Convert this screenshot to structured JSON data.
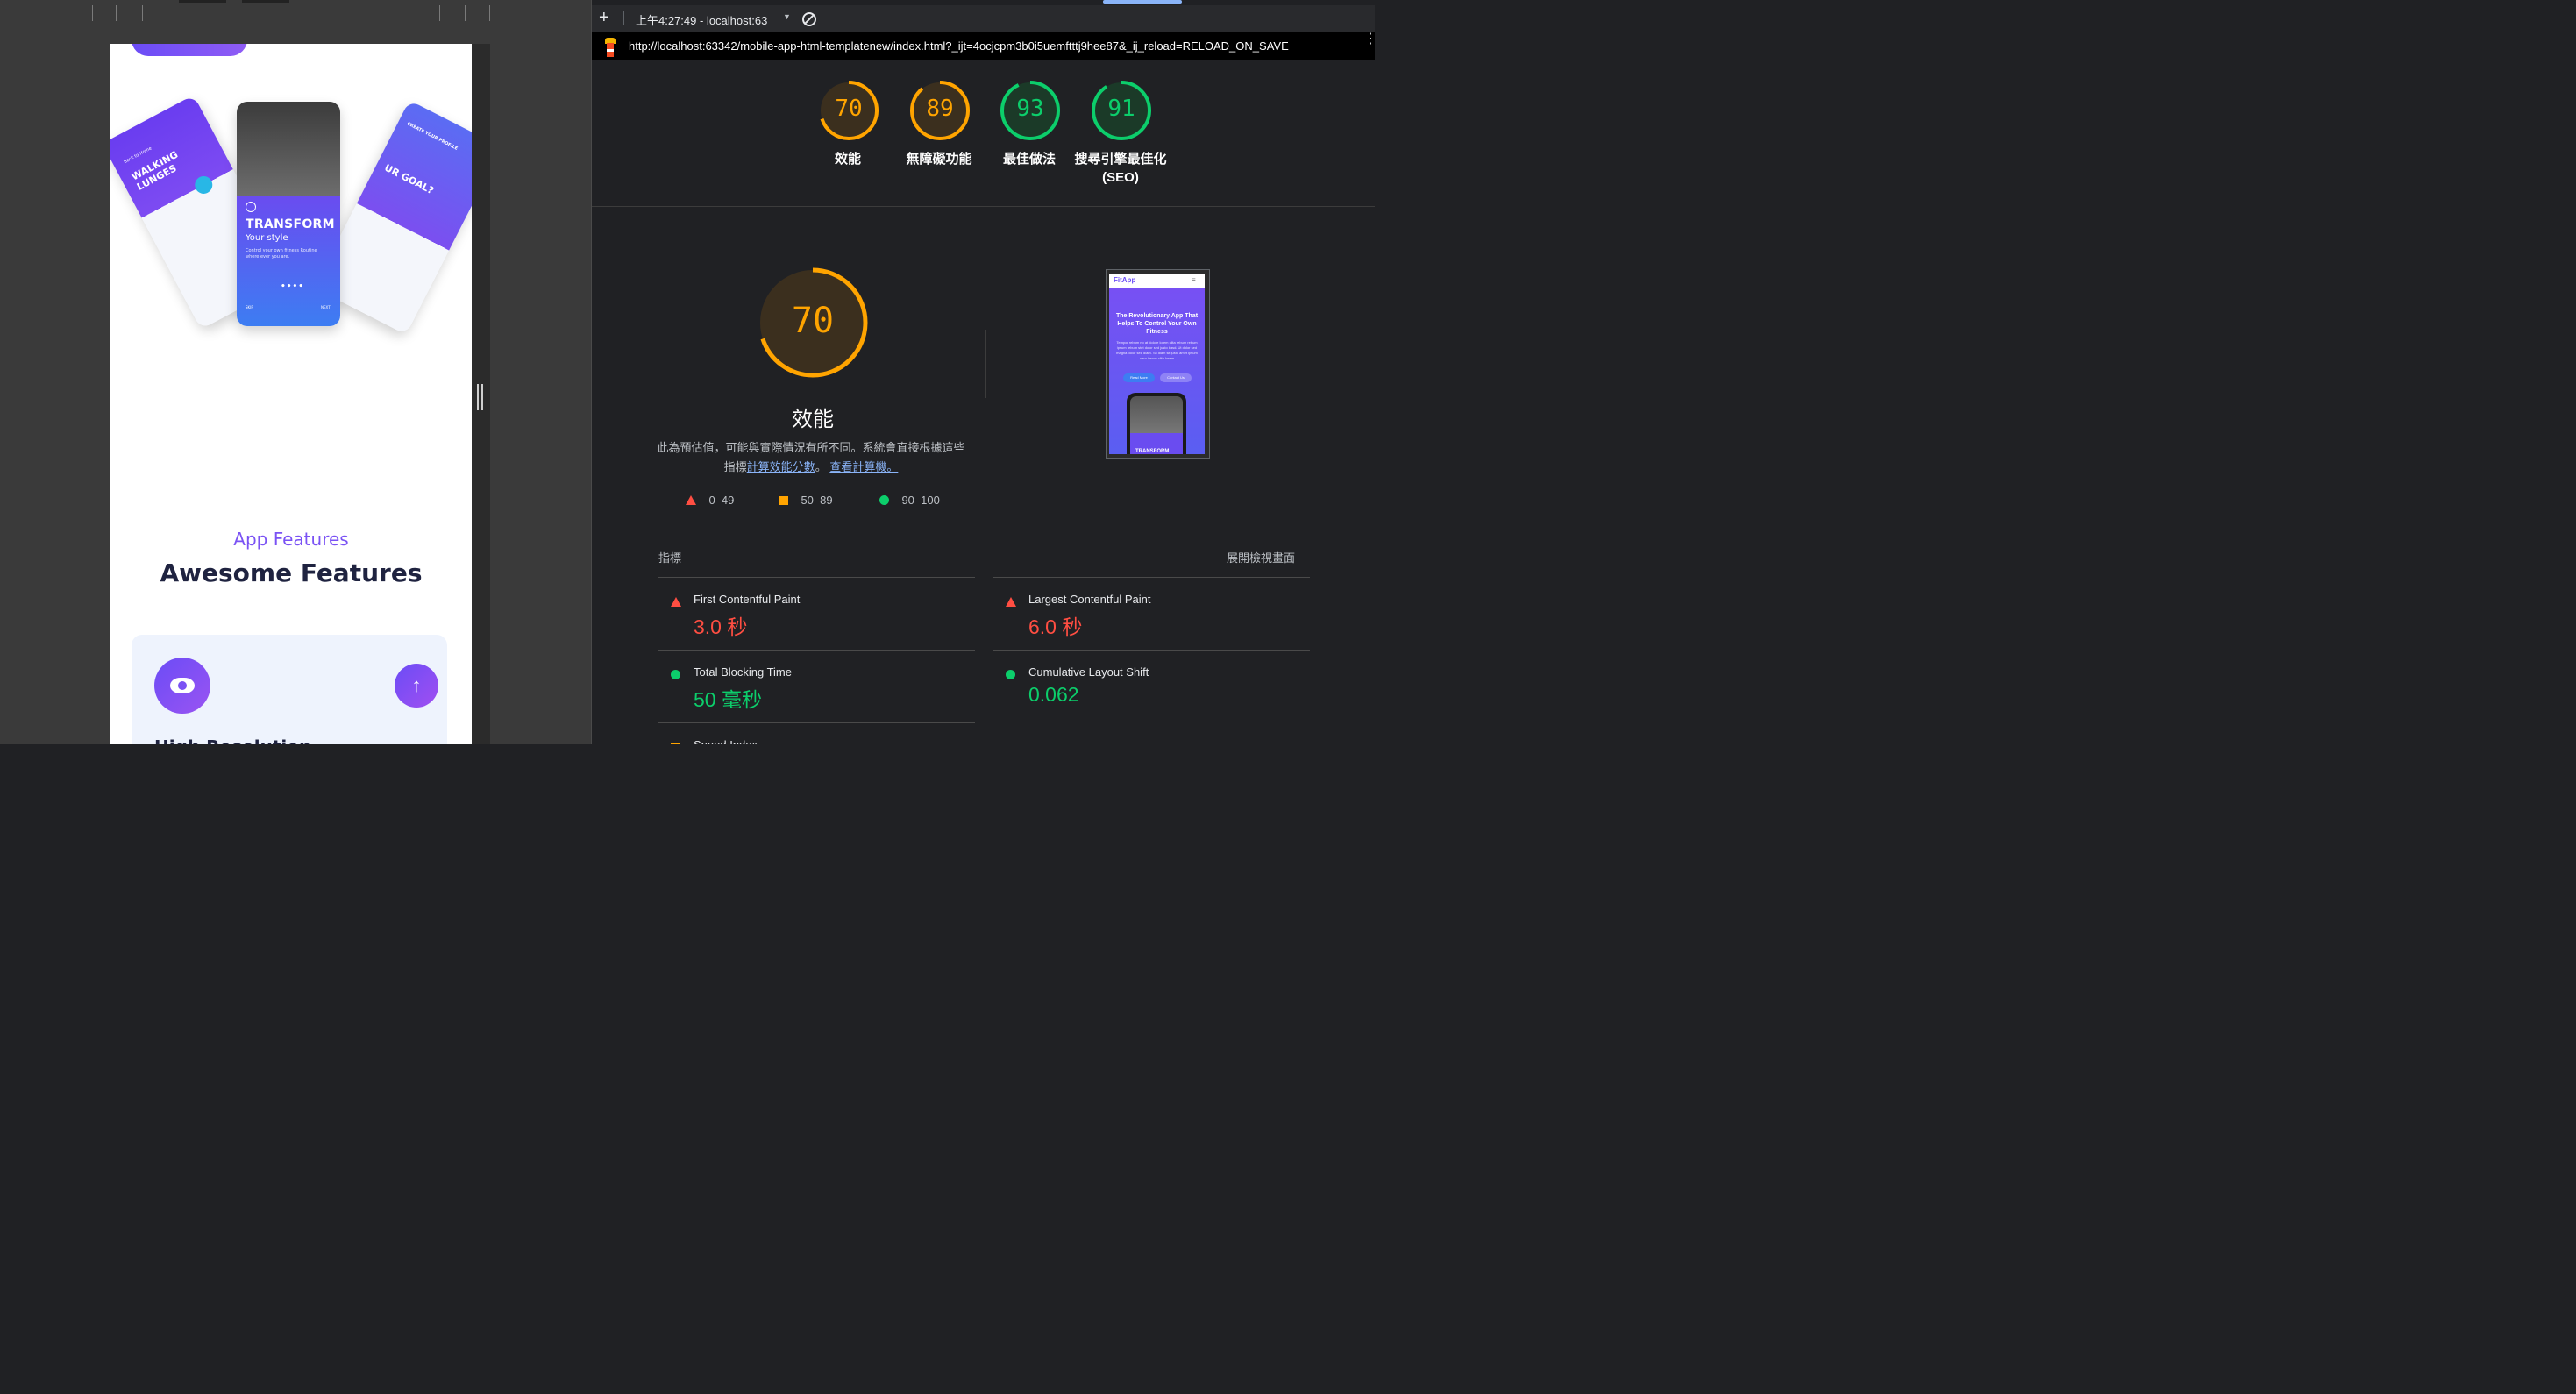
{
  "preview": {
    "hero_phones": {
      "center_title": "TRANSFORM",
      "center_subtitle": "Your style",
      "center_body": "Control your own fitness Routine where ever you are.",
      "center_skip": "SKIP",
      "center_next": "NEXT",
      "left_title": "WALKING LUNGES",
      "left_back": "Back to Home",
      "right_title": "UR GOAL?",
      "right_small": "CREATE YOUR PROFILE"
    },
    "section_eyebrow": "App Features",
    "section_title": "Awesome Features",
    "feature_label": "High Resolution",
    "scroll_top_glyph": "↑"
  },
  "devtools": {
    "toolbar": {
      "add_glyph": "+",
      "report_selector": "上午4:27:49 - localhost:63",
      "caret_glyph": "▼"
    },
    "url": "http://localhost:63342/mobile-app-html-templatenew/index.html?_ijt=4ocjcpm3b0i5uemftttj9hee87&_ij_reload=RELOAD_ON_SAVE",
    "more_glyph": "⋮",
    "scores": [
      {
        "value": "70",
        "label": "效能",
        "color": "#ffa400"
      },
      {
        "value": "89",
        "label": "無障礙功能",
        "color": "#ffa400"
      },
      {
        "value": "93",
        "label": "最佳做法",
        "color": "#0cce6b"
      },
      {
        "value": "91",
        "label": "搜尋引擎最佳化",
        "label2": "(SEO)",
        "color": "#0cce6b"
      }
    ],
    "performance": {
      "score": "70",
      "title": "效能",
      "desc_line1": "此為預估值，可能與實際情況有所不同。系統會直接根據這些",
      "desc_prefix": "指標",
      "desc_link1": "計算效能分數",
      "desc_mid": "。",
      "desc_link2": "查看計算機。",
      "legend": [
        {
          "range": "0–49",
          "color": "#ff4e42"
        },
        {
          "range": "50–89",
          "color": "#ffa400"
        },
        {
          "range": "90–100",
          "color": "#0cce6b"
        }
      ]
    },
    "screenshot_preview": {
      "brand": "FitApp",
      "menu_glyph": "≡",
      "headline": "The Revolutionary App That Helps To Control Your Own Fitness",
      "body": "Tempor rebum no at dolore lorem clita rebum rebum ipsum rebum stet dolor sed justo kasd. Ut dolor sed magna dolor sea diam. Sit diam sit justo amet ipsum vero ipsum clita lorem",
      "btn_read": "Read More",
      "btn_contact": "Contact Us",
      "phone_text": "TRANSFORM"
    },
    "metrics_header": "指標",
    "metrics_expand": "展開檢視畫面",
    "metrics": [
      {
        "name": "First Contentful Paint",
        "value": "3.0 秒",
        "color": "#ff4e42",
        "indicator": "triangle"
      },
      {
        "name": "Largest Contentful Paint",
        "value": "6.0 秒",
        "color": "#ff4e42",
        "indicator": "triangle"
      },
      {
        "name": "Total Blocking Time",
        "value": "50 毫秒",
        "color": "#0cce6b",
        "indicator": "circle"
      },
      {
        "name": "Cumulative Layout Shift",
        "value": "0.062",
        "color": "#0cce6b",
        "indicator": "circle"
      },
      {
        "name": "Speed Index",
        "value": "",
        "color": "#ffa400",
        "indicator": "square"
      }
    ]
  }
}
